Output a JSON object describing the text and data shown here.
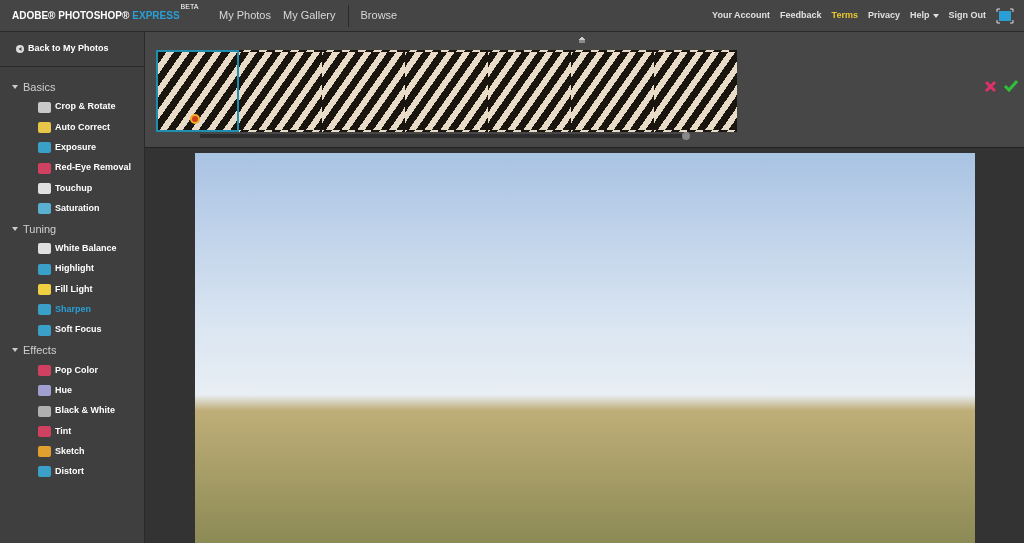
{
  "brand": {
    "name": "ADOBE® PHOTOSHOP®",
    "product": "EXPRESS",
    "badge": "BETA"
  },
  "nav": [
    {
      "label": "My Photos"
    },
    {
      "label": "My Gallery"
    },
    {
      "label": "Browse"
    }
  ],
  "account_links": [
    {
      "label": "Your Account",
      "selected": false
    },
    {
      "label": "Feedback",
      "selected": false
    },
    {
      "label": "Terms",
      "selected": true
    },
    {
      "label": "Privacy",
      "selected": false
    },
    {
      "label": "Help",
      "selected": false,
      "kind": "menu"
    },
    {
      "label": "Sign Out",
      "selected": false
    }
  ],
  "back_link": "Back to My Photos",
  "sidebar": [
    {
      "title": "Basics",
      "expanded": true,
      "children": [
        {
          "label": "Crop & Rotate",
          "selected": false
        },
        {
          "label": "Auto Correct",
          "selected": false
        },
        {
          "label": "Exposure",
          "selected": false
        },
        {
          "label": "Red-Eye Removal",
          "selected": false
        },
        {
          "label": "Touchup",
          "selected": false
        },
        {
          "label": "Saturation",
          "selected": false
        }
      ]
    },
    {
      "title": "Tuning",
      "expanded": true,
      "children": [
        {
          "label": "White Balance",
          "selected": false
        },
        {
          "label": "Highlight",
          "selected": false
        },
        {
          "label": "Fill Light",
          "selected": false
        },
        {
          "label": "Sharpen",
          "selected": true
        },
        {
          "label": "Soft Focus",
          "selected": false
        }
      ]
    },
    {
      "title": "Effects",
      "expanded": true,
      "children": [
        {
          "label": "Pop Color",
          "selected": false
        },
        {
          "label": "Hue",
          "selected": false
        },
        {
          "label": "Black & White",
          "selected": false
        },
        {
          "label": "Tint",
          "selected": false
        },
        {
          "label": "Sketch",
          "selected": false
        },
        {
          "label": "Distort",
          "selected": false
        }
      ]
    }
  ],
  "variations": [
    {
      "selected": true
    },
    {
      "selected": false
    },
    {
      "selected": false
    },
    {
      "selected": false
    },
    {
      "selected": false
    },
    {
      "selected": false
    },
    {
      "selected": false
    }
  ]
}
